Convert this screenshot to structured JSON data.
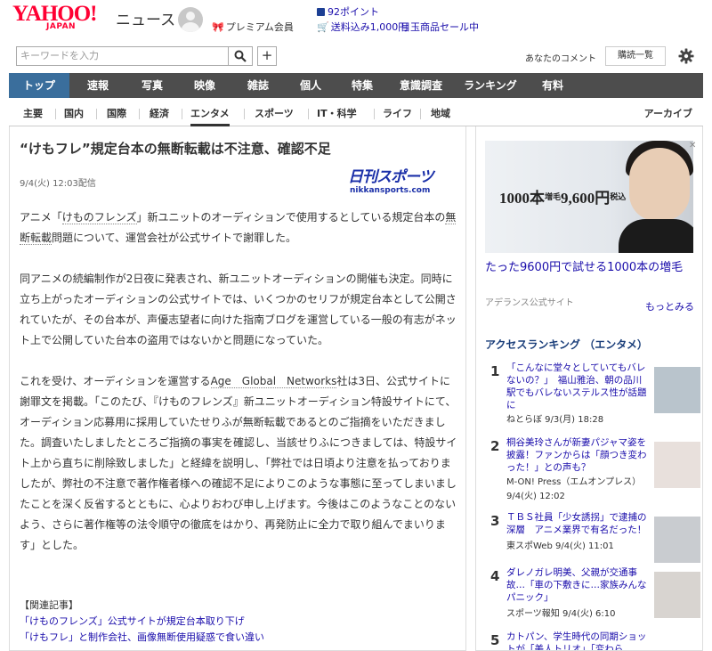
{
  "header": {
    "logo": "YAHOO!",
    "logo_sub": "JAPAN",
    "section": "ニュース",
    "premium": "プレミアム会員",
    "points": "92ポイント",
    "shipping": "送料込み1,000円",
    "sale": "目玉商品セール中"
  },
  "search": {
    "placeholder": "キーワードを入力",
    "plus": "+",
    "comment_link": "あなたのコメント",
    "list_button": "購読一覧"
  },
  "main_nav": [
    {
      "label": "トップ",
      "active": true
    },
    {
      "label": "速報"
    },
    {
      "label": "写真"
    },
    {
      "label": "映像"
    },
    {
      "label": "雑誌"
    },
    {
      "label": "個人"
    },
    {
      "label": "特集"
    },
    {
      "label": "意識調査"
    },
    {
      "label": "ランキング"
    },
    {
      "label": "有料"
    }
  ],
  "sub_nav": [
    {
      "label": "主要"
    },
    {
      "label": "国内"
    },
    {
      "label": "国際"
    },
    {
      "label": "経済"
    },
    {
      "label": "エンタメ",
      "active": true
    },
    {
      "label": "スポーツ"
    },
    {
      "label": "IT・科学"
    },
    {
      "label": "ライフ"
    },
    {
      "label": "地域"
    }
  ],
  "archive": "アーカイブ",
  "article": {
    "title": "“けもフレ”規定台本の無断転載は不注意、確認不足",
    "date": "9/4(火) 12:03配信",
    "source_logo_main": "日刊スポーツ",
    "source_logo_sub": "nikkansports.com",
    "p1_a": "アニメ「",
    "p1_link": "けものフレンズ",
    "p1_b": "」新ユニットのオーディションで使用するとしている規定台本の",
    "p1_link2": "無断転載",
    "p1_c": "問題について、運営会社が公式サイトで謝罪した。",
    "p2": "同アニメの続編制作が2日夜に発表され、新ユニットオーディションの開催も決定。同時に立ち上がったオーディションの公式サイトでは、いくつかのセリフが規定台本として公開されていたが、その台本が、声優志望者に向けた指南ブログを運営している一般の有志がネット上で公開していた台本の盗用ではないかと問題になっていた。",
    "p3_a": "これを受け、オーディションを運営する",
    "p3_link": "Age　Global　Networks",
    "p3_b": "社は3日、公式サイトに謝罪文を掲載。「このたび、『けものフレンズ』新ユニットオーディション特設サイトにて、オーディション応募用に採用していたせりふが無断転載であるとのご指摘をいただきました。調査いたしましたところご指摘の事実を確認し、当該せりふにつきましては、特設サイト上から直ちに削除致しました」と経緯を説明し、「弊社では日頃より注意を払っておりましたが、弊社の不注意で著作権者様への確認不足によりこのような事態に至ってしまいましたことを深く反省するとともに、心よりおわび申し上げます。今後はこのようなことのないよう、さらに著作権等の法令順守の徹底をはかり、再発防止に全力で取り組んでまいります」とした。",
    "related_head": "【関連記事】",
    "related": [
      "「けものフレンズ」公式サイトが規定台本取り下げ",
      "「けもフレ」と制作会社、画像無断使用疑惑で食い違い"
    ]
  },
  "sidebar": {
    "ad_text_big": "1000本",
    "ad_text_mid": "増毛",
    "ad_text_price": "9,600円",
    "ad_text_tax": "税込",
    "ad_title": "たった9600円で試せる1000本の増毛",
    "ad_source": "アデランス公式サイト",
    "ad_more": "もっとみる",
    "ad_close": "✕",
    "ranking_title": "アクセスランキング （エンタメ）",
    "ranking": [
      {
        "num": "1",
        "text": "「こんなに堂々としていてもバレないの？」　福山雅治、朝の品川駅でもバレないステルス性が話題に",
        "meta": "ねとらぼ 9/3(月) 18:28"
      },
      {
        "num": "2",
        "text": "桐谷美玲さんが新妻パジャマ姿を披露！ファンからは「顔つき変わった！」との声も？",
        "meta": "M-ON! Press（エムオンプレス）",
        "meta2": "9/4(火) 12:02"
      },
      {
        "num": "3",
        "text": "ＴＢＳ社員「少女誘拐」で逮捕の深層　アニメ業界で有名だった！",
        "meta": "東スポWeb 9/4(火) 11:01"
      },
      {
        "num": "4",
        "text": "ダレノガレ明美、父親が交通事故…「車の下敷きに…家族みんなパニック」",
        "meta": "スポーツ報知 9/4(火) 6:10"
      },
      {
        "num": "5",
        "text": "カトパン、学生時代の同期ショットが「美人トリオ」「変わら",
        "meta": ""
      }
    ],
    "thumb_colors": [
      "#b9c4cc",
      "#e8e0dc",
      "#c9ccd0",
      "#d8d4d0"
    ]
  },
  "colors": {
    "brand": "#ff0033",
    "nav_bg": "#4d4d4d",
    "nav_active": "#3a6e9c",
    "link": "#1a0dab"
  }
}
